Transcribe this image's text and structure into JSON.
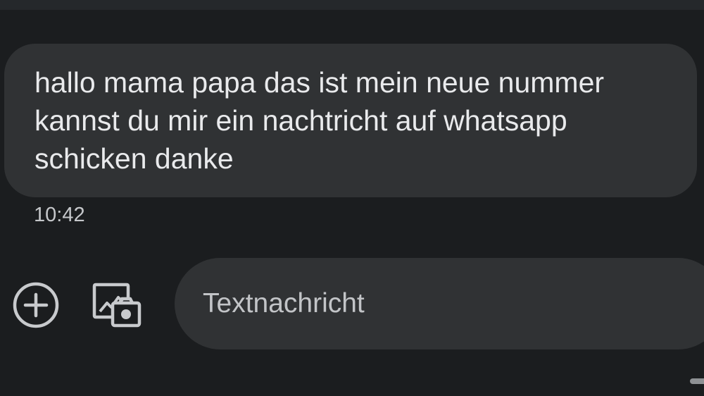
{
  "conversation": {
    "messages": [
      {
        "lines": [
          "hallo mama papa das ist mein neue nummer",
          "kannst du mir ein nachtricht auf whatsapp",
          "schicken danke"
        ],
        "time": "10:42"
      }
    ]
  },
  "compose": {
    "placeholder": "Textnachricht",
    "value": "",
    "add_icon": "add-circle-icon",
    "media_icon": "gallery-camera-icon"
  },
  "colors": {
    "background": "#1b1d1f",
    "bubble": "#303234",
    "text": "#e9eaec",
    "icon": "#c8cacd"
  }
}
